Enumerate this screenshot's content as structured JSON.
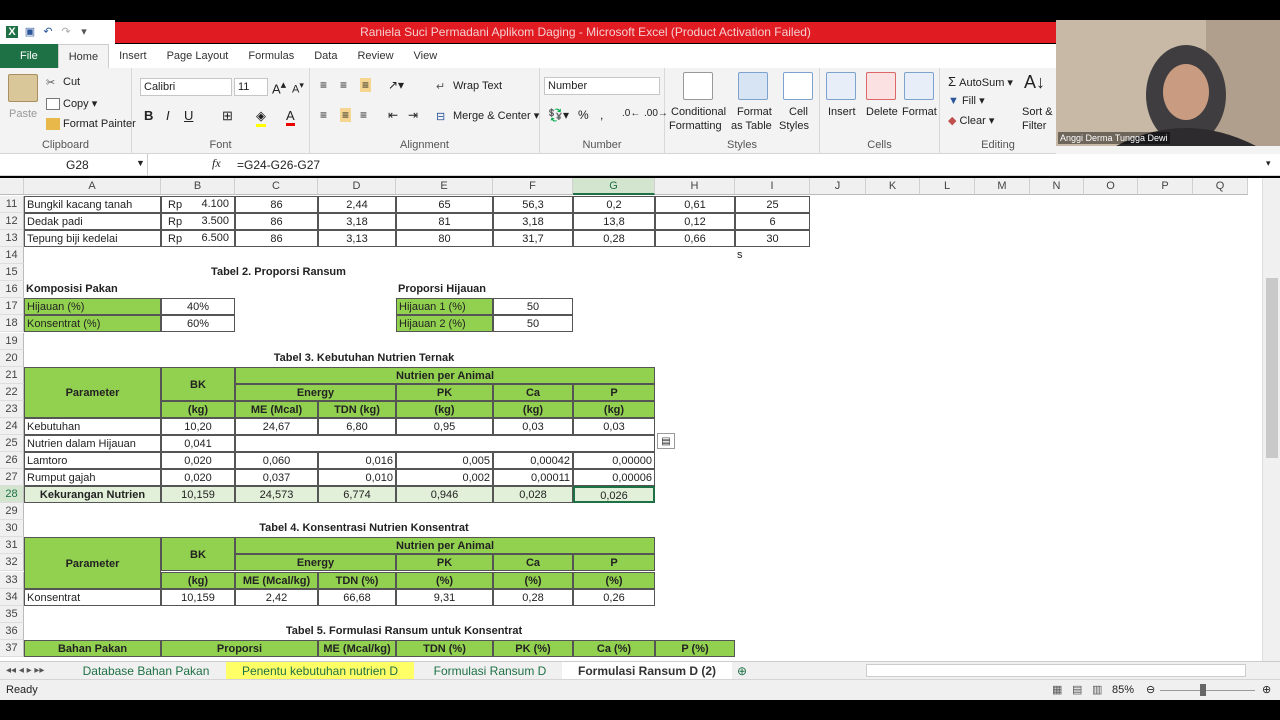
{
  "window": {
    "title": "Raniela Suci Permadani Aplikom Daging - Microsoft Excel (Product Activation Failed)"
  },
  "tabs": [
    "File",
    "Home",
    "Insert",
    "Page Layout",
    "Formulas",
    "Data",
    "Review",
    "View"
  ],
  "ribbon": {
    "clipboard": {
      "label": "Clipboard",
      "paste": "Paste",
      "cut": "Cut",
      "copy": "Copy",
      "format_painter": "Format Painter"
    },
    "font": {
      "label": "Font",
      "name": "Calibri",
      "size": "11"
    },
    "alignment": {
      "label": "Alignment",
      "wrap": "Wrap Text",
      "merge": "Merge & Center"
    },
    "number": {
      "label": "Number",
      "format": "Number"
    },
    "styles": {
      "label": "Styles",
      "conditional": "Conditional",
      "conditional2": "Formatting",
      "format_as": "Format",
      "format_as2": "as Table",
      "cell": "Cell",
      "cell2": "Styles"
    },
    "cells": {
      "label": "Cells",
      "insert": "Insert",
      "delete": "Delete",
      "format": "Format"
    },
    "editing": {
      "label": "Editing",
      "autosum": "AutoSum",
      "fill": "Fill",
      "clear": "Clear",
      "sort": "Sort &",
      "sort2": "Filter"
    }
  },
  "webcam": {
    "name": "Anggi Derma Tungga Dewi"
  },
  "formula_bar": {
    "name_box": "G28",
    "fx": "fx",
    "formula": "=G24-G26-G27"
  },
  "columns": [
    "A",
    "B",
    "C",
    "D",
    "E",
    "F",
    "G",
    "H",
    "I",
    "J",
    "K",
    "L",
    "M",
    "N",
    "O",
    "P",
    "Q"
  ],
  "rows": [
    "11",
    "12",
    "13",
    "14",
    "15",
    "16",
    "17",
    "18",
    "19",
    "20",
    "21",
    "22",
    "23",
    "24",
    "25",
    "26",
    "27",
    "28",
    "29",
    "30",
    "31",
    "32",
    "33",
    "34",
    "35",
    "36",
    "37"
  ],
  "cells": {
    "r11": [
      "Bungkil kacang tanah",
      "Rp",
      "4.100",
      "86",
      "2,44",
      "65",
      "56,3",
      "0,2",
      "0,61",
      "25"
    ],
    "r12": [
      "Dedak padi",
      "Rp",
      "3.500",
      "86",
      "3,18",
      "81",
      "3,18",
      "13,8",
      "0,12",
      "6"
    ],
    "r13": [
      "Tepung biji kedelai",
      "Rp",
      "6.500",
      "86",
      "3,13",
      "80",
      "31,7",
      "0,28",
      "0,66",
      "30"
    ],
    "r14_i": "s",
    "t2_title": "Tabel 2. Proporsi Ransum",
    "komposisi": "Komposisi Pakan",
    "hijauan_pct": "Hijauan (%)",
    "hijauan_val": "40%",
    "konsentrat_pct": "Konsentrat (%)",
    "konsentrat_val": "60%",
    "proporsi_hijauan": "Proporsi Hijauan",
    "hijauan1": "Hijauan 1 (%)",
    "hijauan1_val": "50",
    "hijauan2": "Hijauan 2 (%)",
    "hijauan2_val": "50",
    "t3_title": "Tabel 3. Kebutuhan Nutrien Ternak",
    "t4_title": "Tabel 4. Konsentrasi Nutrien Konsentrat",
    "t5_title": "Tabel 5. Formulasi Ransum untuk Konsentrat",
    "parameter": "Parameter",
    "bk": "BK",
    "nutrien_per_animal": "Nutrien per Animal",
    "energy": "Energy",
    "pk": "PK",
    "ca": "Ca",
    "p": "P",
    "kg": "(kg)",
    "me_mcal": "ME (Mcal)",
    "tdn_kg": "TDN (kg)",
    "me_mcalkg": "ME (Mcal/kg)",
    "tdn_pct": "TDN (%)",
    "pct": "(%)",
    "r24": [
      "Kebutuhan",
      "10,20",
      "24,67",
      "6,80",
      "0,95",
      "0,03",
      "0,03"
    ],
    "r25": [
      "Nutrien dalam Hijauan",
      "0,041"
    ],
    "r26": [
      "Lamtoro",
      "0,020",
      "0,060",
      "0,016",
      "0,005",
      "0,00042",
      "0,00000"
    ],
    "r27": [
      "Rumput gajah",
      "0,020",
      "0,037",
      "0,010",
      "0,002",
      "0,00011",
      "0,00006"
    ],
    "r28": [
      "Kekurangan Nutrien",
      "10,159",
      "24,573",
      "6,774",
      "0,946",
      "0,028",
      "0,026"
    ],
    "r34": [
      "Konsentrat",
      "10,159",
      "2,42",
      "66,68",
      "9,31",
      "0,28",
      "0,26"
    ],
    "r37": [
      "Bahan Pakan",
      "Proporsi",
      "ME (Mcal/kg)",
      "TDN (%)",
      "PK (%)",
      "Ca (%)",
      "P (%)"
    ]
  },
  "sheets": [
    "Database Bahan Pakan",
    "Penentu kebutuhan nutrien D",
    "Formulasi Ransum D",
    "Formulasi Ransum D (2)"
  ],
  "status": {
    "ready": "Ready",
    "zoom": "85%"
  },
  "colors": {
    "excel_green": "#1e7145",
    "title_red": "#e11b22",
    "cell_green": "#92d050"
  }
}
